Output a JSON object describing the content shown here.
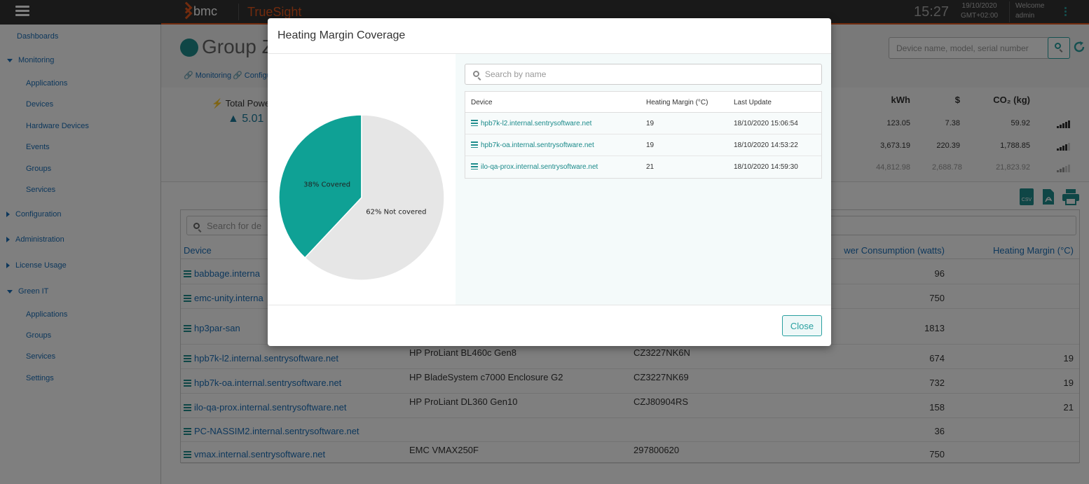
{
  "topbar": {
    "brand": "bmc",
    "product": "TrueSight",
    "time": "15:27",
    "date": "19/10/2020",
    "timezone": "GMT+02:00",
    "welcome": "Welcome",
    "user": "admin"
  },
  "sidebar": {
    "items": [
      {
        "label": "Dashboards",
        "level": 0,
        "caret": "none"
      },
      {
        "label": "Monitoring",
        "level": 0,
        "caret": "down"
      },
      {
        "label": "Applications",
        "level": 1
      },
      {
        "label": "Devices",
        "level": 1
      },
      {
        "label": "Hardware Devices",
        "level": 1
      },
      {
        "label": "Events",
        "level": 1
      },
      {
        "label": "Groups",
        "level": 1
      },
      {
        "label": "Services",
        "level": 1
      },
      {
        "label": "Configuration",
        "level": 0,
        "caret": "right"
      },
      {
        "label": "Administration",
        "level": 0,
        "caret": "right"
      },
      {
        "label": "License Usage",
        "level": 0,
        "caret": "right"
      },
      {
        "label": "Green IT",
        "level": 0,
        "caret": "down"
      },
      {
        "label": "Applications",
        "level": 1
      },
      {
        "label": "Groups",
        "level": 1
      },
      {
        "label": "Services",
        "level": 1
      },
      {
        "label": "Settings",
        "level": 1
      }
    ]
  },
  "page": {
    "title": "Group Z",
    "tabs": [
      "Monitoring",
      "Configu"
    ],
    "search_placeholder": "Device name, model, serial number"
  },
  "summary": {
    "total_label": "Total Power",
    "total_value": "5.01",
    "headers": {
      "kwh": "kWh",
      "usd": "$",
      "co2": "CO₂ (kg)"
    },
    "rows": [
      {
        "kwh": "123.05",
        "usd": "7.38",
        "co2": "59.92"
      },
      {
        "kwh": "3,673.19",
        "usd": "220.39",
        "co2": "1,788.85"
      },
      {
        "kwh": "44,812.98",
        "usd": "2,688.78",
        "co2": "21,823.92"
      }
    ]
  },
  "exports": {
    "csv": "CSV"
  },
  "grid": {
    "search_placeholder": "Search for de",
    "headers": {
      "device": "Device",
      "power": "wer Consumption (watts)",
      "heating": "Heating Margin (°C)"
    },
    "rows": [
      {
        "device": "babbage.interna",
        "model": "",
        "serial": "",
        "power": "96",
        "heating": ""
      },
      {
        "device": "emc-unity.interna",
        "model": "",
        "serial": "",
        "power": "750",
        "heating": ""
      },
      {
        "device": "hp3par-san",
        "model": "",
        "serial": "",
        "power": "1813",
        "heating": ""
      },
      {
        "device": "hpb7k-l2.internal.sentrysoftware.net",
        "model": "HP ProLiant BL460c Gen8",
        "serial": "CZ3227NK6N",
        "power": "674",
        "heating": "19"
      },
      {
        "device": "hpb7k-oa.internal.sentrysoftware.net",
        "model": "HP BladeSystem c7000 Enclosure G2",
        "serial": "CZ3227NK69",
        "power": "732",
        "heating": "19"
      },
      {
        "device": "ilo-qa-prox.internal.sentrysoftware.net",
        "model": "HP ProLiant DL360 Gen10",
        "serial": "CZJ80904RS",
        "power": "158",
        "heating": "21"
      },
      {
        "device": "PC-NASSIM2.internal.sentrysoftware.net",
        "model": "",
        "serial": "",
        "power": "36",
        "heating": ""
      },
      {
        "device": "vmax.internal.sentrysoftware.net",
        "model": "EMC VMAX250F",
        "serial": "297800620",
        "power": "750",
        "heating": ""
      }
    ]
  },
  "modal": {
    "title": "Heating Margin Coverage",
    "search_placeholder": "Search by name",
    "table_headers": {
      "device": "Device",
      "heating": "Heating Margin (°C)",
      "update": "Last Update"
    },
    "rows": [
      {
        "device": "hpb7k-l2.internal.sentrysoftware.net",
        "heating": "19",
        "update": "18/10/2020 15:06:54"
      },
      {
        "device": "hpb7k-oa.internal.sentrysoftware.net",
        "heating": "19",
        "update": "18/10/2020 14:53:22"
      },
      {
        "device": "ilo-qa-prox.internal.sentrysoftware.net",
        "heating": "21",
        "update": "18/10/2020 14:59:30"
      }
    ],
    "close_label": "Close"
  },
  "chart_data": {
    "type": "pie",
    "categories": [
      "Covered",
      "Not covered"
    ],
    "values": [
      38,
      62
    ],
    "labels": [
      "38% Covered",
      "62% Not covered"
    ],
    "colors": [
      "#0fa195",
      "#e6e6e6"
    ]
  }
}
